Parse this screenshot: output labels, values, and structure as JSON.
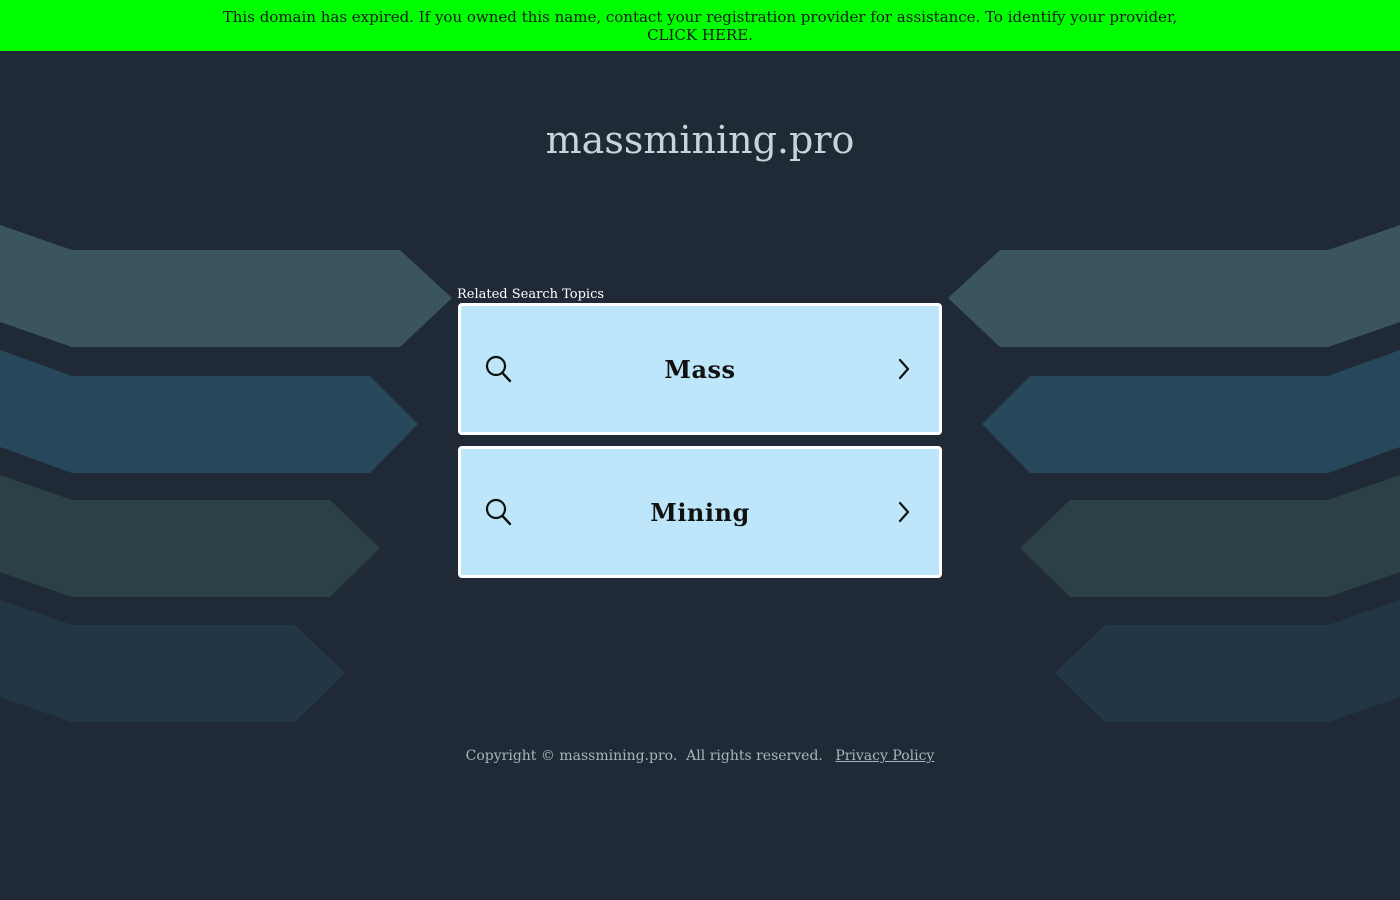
{
  "banner": {
    "line1": "This domain has expired. If you owned this name, contact your registration provider for assistance. To identify your provider,",
    "link": "CLICK HERE.",
    "color": "#00ff00"
  },
  "domain": "massmining.pro",
  "related_label": "Related Search Topics",
  "topics": [
    {
      "label": "Mass"
    },
    {
      "label": "Mining"
    }
  ],
  "footer": {
    "copyright": "Copyright © massmining.pro.  All rights reserved.",
    "privacy": "Privacy Policy"
  },
  "icons": {
    "search": "search-icon",
    "chevron": "chevron-right-icon"
  },
  "colors": {
    "background": "#1f2a36",
    "topic_fill": "#bde6fa"
  }
}
